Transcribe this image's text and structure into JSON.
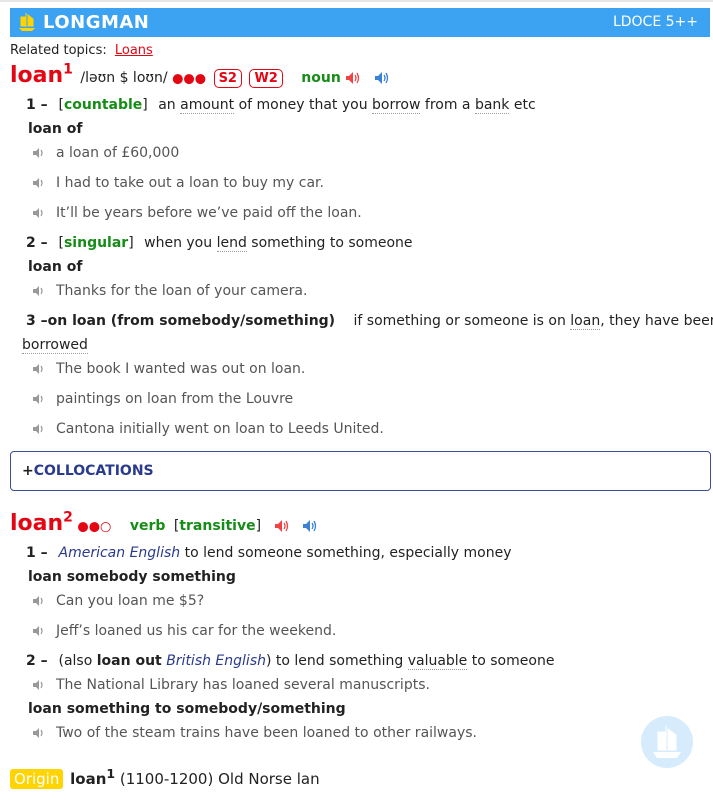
{
  "header": {
    "brand": "LONGMAN",
    "edition": "LDOCE 5++"
  },
  "related": {
    "label": "Related topics:",
    "link": "Loans"
  },
  "entry1": {
    "headword": "loan",
    "homnum": "1",
    "pron": "/ləʊn $ loʊn/",
    "freq": "●●●",
    "badges": [
      "S2",
      "W2"
    ],
    "pos": "noun",
    "senses": [
      {
        "num": "1",
        "gram": "countable",
        "def_parts": [
          "an ",
          "amount",
          " of money that you ",
          "borrow",
          " from a ",
          "bank",
          " etc"
        ],
        "pattern": "loan of",
        "examples": [
          "a loan of £60,000",
          "I had to take out a loan to buy my car.",
          "It’ll be years before we’ve paid off the loan."
        ]
      },
      {
        "num": "2",
        "gram": "singular",
        "def_parts": [
          "when you ",
          "lend",
          " something to someone"
        ],
        "pattern": "loan of",
        "examples": [
          "Thanks for the loan of your camera."
        ]
      },
      {
        "num": "3",
        "phrase": "on loan (from somebody/something)",
        "def_line1_parts": [
          "if something or someone is on ",
          "loan",
          ", they have been"
        ],
        "def_line2": "borrowed",
        "examples": [
          "The book I wanted was out on loan.",
          "paintings on loan from the Louvre",
          "Cantona initially went on loan to Leeds United."
        ]
      }
    ]
  },
  "collocations": {
    "label": "COLLOCATIONS"
  },
  "entry2": {
    "headword": "loan",
    "homnum": "2",
    "freq": "●●○",
    "pos": "verb",
    "gram": "transitive",
    "senses": [
      {
        "num": "1",
        "region": "American English",
        "def": " to lend someone something, especially money",
        "pattern": "loan somebody something",
        "examples": [
          "Can you loan me $5?",
          "Jeff’s loaned us his car for the weekend."
        ]
      },
      {
        "num": "2",
        "also_open": "(also ",
        "also_phrase": "loan out",
        "region": "British English",
        "def_parts": [
          ") to lend something ",
          "valuable",
          " to someone"
        ],
        "examples": [
          "The National Library has loaned several manuscripts."
        ],
        "pattern": "loan something to somebody/something",
        "examples2": [
          "Two of the steam trains have been loaned to other railways."
        ]
      }
    ]
  },
  "origin": {
    "label": "Origin",
    "headword": "loan",
    "homnum": "1",
    "text": "(1100-1200) Old Norse lan"
  },
  "colors": {
    "header": "#3ba3f2",
    "headword": "#e30613",
    "pos": "#168d16",
    "origin": "#ffd400"
  }
}
